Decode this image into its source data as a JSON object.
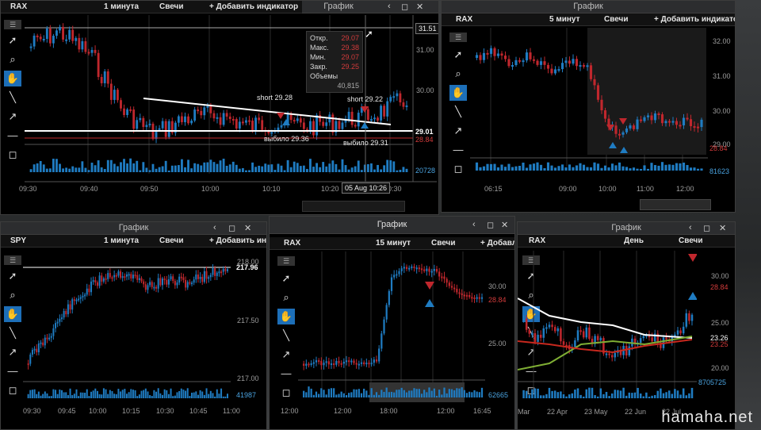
{
  "watermark": "hamaha.net",
  "colors": {
    "up": "#1f7cc2",
    "down": "#c0272d",
    "accent": "#1d6fb8",
    "line": "#ffffff",
    "ema_green": "#7fae34",
    "ema_red": "#c8281e"
  },
  "w1": {
    "title": "График",
    "symbol": "RAX",
    "interval": "1 минута",
    "chart_type": "Свечи",
    "add_indicator": "+ Добавить индикатор",
    "y_ticks": [
      "31.00",
      "30.00"
    ],
    "price_top": "31.51",
    "price_last": "29.01",
    "price_red": "28.84",
    "volume_label": "20728",
    "x_ticks": [
      "09:30",
      "09:40",
      "09:50",
      "10:00",
      "10:10",
      "10:20",
      "10:30"
    ],
    "cursor_time": "05 Aug 10:26",
    "info": {
      "open_l": "Откр.",
      "open_v": "29.07",
      "high_l": "Макс.",
      "high_v": "29.38",
      "low_l": "Мин.",
      "low_v": "29.07",
      "close_l": "Закр.",
      "close_v": "29.25",
      "vol_l": "Объемы",
      "vol_v": "40,815"
    },
    "ann_short1": "short 29.28",
    "ann_short2": "short 29.22",
    "ann_exit1": "выбило 29.36",
    "ann_exit2": "выбило 29.31"
  },
  "w2": {
    "title": "График",
    "symbol": "RAX",
    "interval": "5 минут",
    "chart_type": "Свечи",
    "add_indicator": "+ Добавить индикатор",
    "y_ticks": [
      "32.00",
      "31.00",
      "30.00",
      "29.00"
    ],
    "price_red": "28.84",
    "volume_label": "81623",
    "x_ticks": [
      "06:15",
      "09:00",
      "10:00",
      "11:00",
      "12:00"
    ]
  },
  "w3": {
    "title": "График",
    "symbol": "SPY",
    "interval": "1 минута",
    "chart_type": "Свечи",
    "add_indicator": "+ Добавить индикатор",
    "y_ticks": [
      "218.00",
      "217.50",
      "217.00"
    ],
    "price_last": "217.96",
    "volume_label": "41987",
    "x_ticks": [
      "09:30",
      "09:45",
      "10:00",
      "10:15",
      "10:30",
      "10:45",
      "11:00"
    ]
  },
  "w4": {
    "title": "График",
    "symbol": "RAX",
    "interval": "15 минут",
    "chart_type": "Свечи",
    "add_indicator": "+ Добавле",
    "y_ticks": [
      "30.00",
      "25.00"
    ],
    "price_red": "28.84",
    "volume_label": "62665",
    "x_ticks": [
      "12:00",
      "12:00",
      "18:00",
      "12:00",
      "16:45"
    ]
  },
  "w5": {
    "title": "График",
    "symbol": "RAX",
    "interval": "День",
    "chart_type": "Свечи",
    "y_ticks": [
      "30.00",
      "25.00",
      "20.00"
    ],
    "price_red": "28.84",
    "price_last": "23.26",
    "price_last2": "23.25",
    "volume_label": "8705725",
    "x_ticks": [
      "Mar",
      "22 Apr",
      "23 May",
      "22 Jun",
      "22 Jul"
    ]
  }
}
